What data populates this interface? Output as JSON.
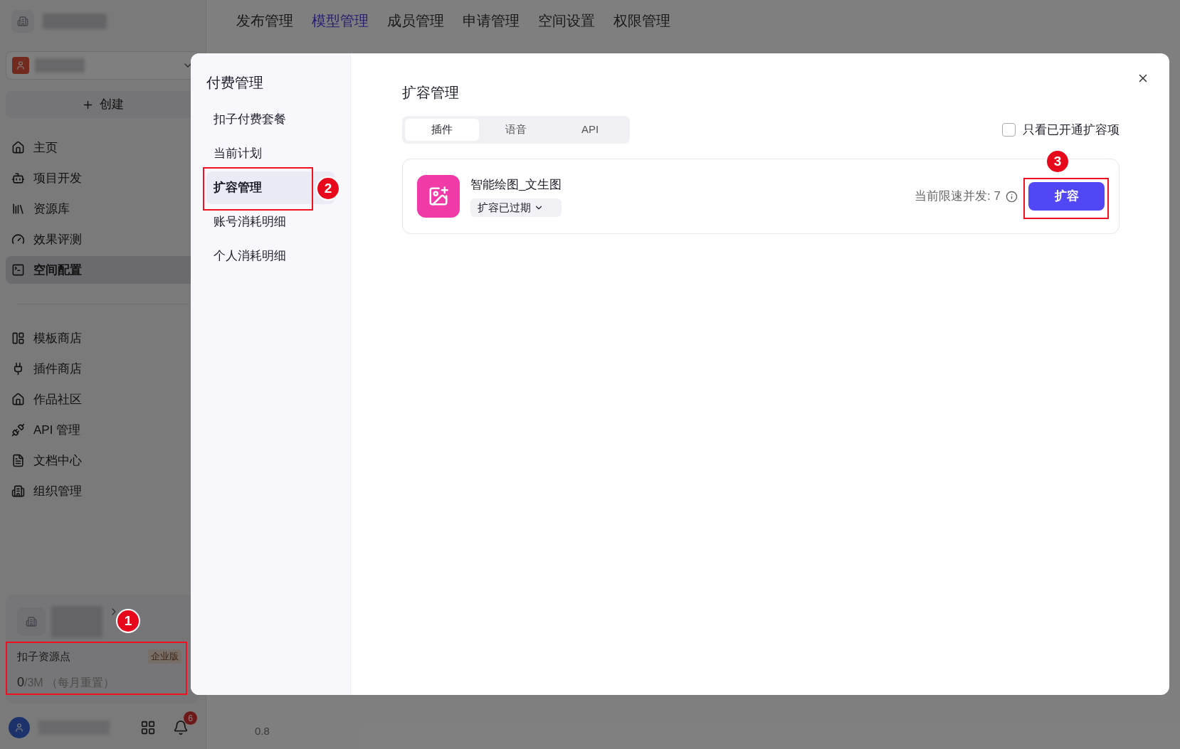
{
  "sidebar": {
    "create_label": "创建",
    "nav": [
      {
        "label": "主页",
        "selected": false
      },
      {
        "label": "项目开发",
        "selected": false
      },
      {
        "label": "资源库",
        "selected": false
      },
      {
        "label": "效果评测",
        "selected": false
      },
      {
        "label": "空间配置",
        "selected": true
      }
    ],
    "nav_secondary": [
      {
        "label": "模板商店"
      },
      {
        "label": "插件商店"
      },
      {
        "label": "作品社区"
      },
      {
        "label": "API 管理"
      },
      {
        "label": "文档中心"
      },
      {
        "label": "组织管理"
      }
    ],
    "resource_card": {
      "title": "扣子资源点",
      "badge": "企业版",
      "used": "0",
      "total": "/3M",
      "note": "（每月重置）"
    },
    "notification_count": "6"
  },
  "top_tabs": [
    {
      "label": "发布管理",
      "selected": false
    },
    {
      "label": "模型管理",
      "selected": true
    },
    {
      "label": "成员管理",
      "selected": false
    },
    {
      "label": "申请管理",
      "selected": false
    },
    {
      "label": "空间设置",
      "selected": false
    },
    {
      "label": "权限管理",
      "selected": false
    }
  ],
  "axis_label": "0.8",
  "modal": {
    "title": "付费管理",
    "nav": [
      {
        "label": "扣子付费套餐",
        "selected": false
      },
      {
        "label": "当前计划",
        "selected": false
      },
      {
        "label": "扩容管理",
        "selected": true
      },
      {
        "label": "账号消耗明细",
        "selected": false
      },
      {
        "label": "个人消耗明细",
        "selected": false
      }
    ],
    "section_title": "扩容管理",
    "tabs": [
      {
        "label": "插件",
        "selected": true
      },
      {
        "label": "语音",
        "selected": false
      },
      {
        "label": "API",
        "selected": false
      }
    ],
    "filter": {
      "label": "只看已开通扩容项",
      "checked": false
    },
    "items": [
      {
        "name": "智能绘图_文生图",
        "status": "扩容已过期",
        "limit": "当前限速并发: 7",
        "action": "扩容"
      }
    ]
  },
  "annotations": [
    {
      "label": "1"
    },
    {
      "label": "2"
    },
    {
      "label": "3"
    }
  ]
}
